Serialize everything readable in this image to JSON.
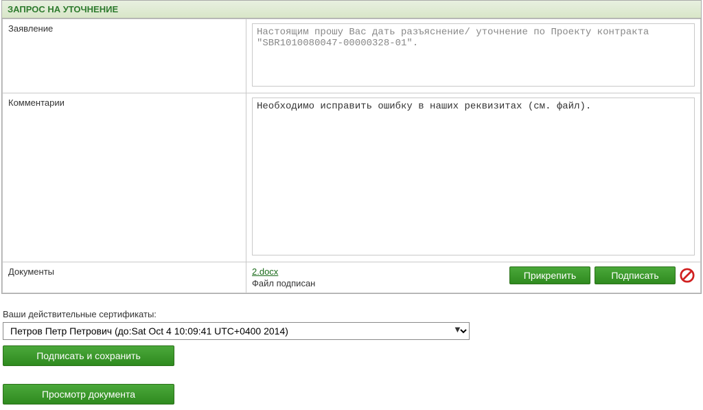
{
  "panel": {
    "title": "ЗАПРОС НА УТОЧНЕНИЕ"
  },
  "form": {
    "statement": {
      "label": "Заявление",
      "value": "Настоящим прошу Вас дать разъяснение/ уточнение по Проекту контракта \"SBR1010080047-00000328-01\"."
    },
    "comments": {
      "label": "Комментарии",
      "value": "Необходимо исправить ошибку в наших реквизитах (см. файл)."
    },
    "documents": {
      "label": "Документы",
      "file_name": "2.docx",
      "file_status": "Файл подписан",
      "attach_label": "Прикрепить",
      "sign_label": "Подписать"
    }
  },
  "certificates": {
    "label": "Ваши действительные сертификаты:",
    "selected": "Петров Петр Петрович (до:Sat Oct 4 10:09:41 UTC+0400 2014)"
  },
  "actions": {
    "sign_save": "Подписать и сохранить",
    "preview": "Просмотр документа"
  }
}
